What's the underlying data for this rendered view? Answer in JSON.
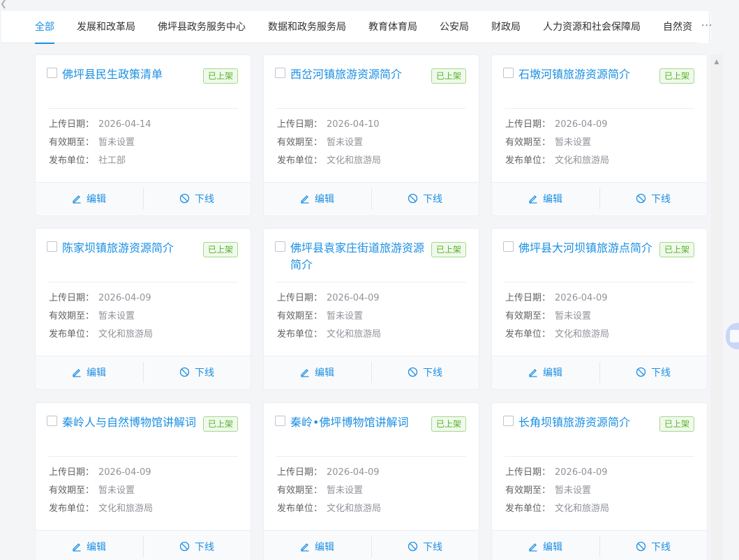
{
  "tabs": [
    {
      "label": "全部",
      "active": true
    },
    {
      "label": "发展和改革局",
      "active": false
    },
    {
      "label": "佛坪县政务服务中心",
      "active": false
    },
    {
      "label": "数据和政务服务局",
      "active": false
    },
    {
      "label": "教育体育局",
      "active": false
    },
    {
      "label": "公安局",
      "active": false
    },
    {
      "label": "财政局",
      "active": false
    },
    {
      "label": "人力资源和社会保障局",
      "active": false
    },
    {
      "label": "自然资",
      "active": false
    }
  ],
  "tab_more": "···",
  "labels": {
    "upload_date": "上传日期：",
    "valid_until": "有效期至：",
    "publisher": "发布单位：",
    "edit": "编辑",
    "offline": "下线"
  },
  "cards": [
    {
      "title": "佛坪县民生政策清单",
      "status": "已上架",
      "upload_date": "2026-04-14",
      "valid_until": "暂未设置",
      "publisher": "社工部"
    },
    {
      "title": "西岔河镇旅游资源简介",
      "status": "已上架",
      "upload_date": "2026-04-10",
      "valid_until": "暂未设置",
      "publisher": "文化和旅游局"
    },
    {
      "title": "石墩河镇旅游资源简介",
      "status": "已上架",
      "upload_date": "2026-04-09",
      "valid_until": "暂未设置",
      "publisher": "文化和旅游局"
    },
    {
      "title": "陈家坝镇旅游资源简介",
      "status": "已上架",
      "upload_date": "2026-04-09",
      "valid_until": "暂未设置",
      "publisher": "文化和旅游局"
    },
    {
      "title": "佛坪县袁家庄街道旅游资源简介",
      "status": "已上架",
      "upload_date": "2026-04-09",
      "valid_until": "暂未设置",
      "publisher": "文化和旅游局"
    },
    {
      "title": "佛坪县大河坝镇旅游点简介",
      "status": "已上架",
      "upload_date": "2026-04-09",
      "valid_until": "暂未设置",
      "publisher": "文化和旅游局"
    },
    {
      "title": "秦岭人与自然博物馆讲解词",
      "status": "已上架",
      "upload_date": "2026-04-09",
      "valid_until": "暂未设置",
      "publisher": "文化和旅游局"
    },
    {
      "title": "秦岭•佛坪博物馆讲解词",
      "status": "已上架",
      "upload_date": "2026-04-09",
      "valid_until": "暂未设置",
      "publisher": "文化和旅游局"
    },
    {
      "title": "长角坝镇旅游资源简介",
      "status": "已上架",
      "upload_date": "2026-04-09",
      "valid_until": "暂未设置",
      "publisher": "文化和旅游局"
    }
  ],
  "icons": {
    "edit": "pencil-icon",
    "offline": "prohibit-icon",
    "back": "chevron-left-icon",
    "scroll_up": "triangle-up-icon",
    "side": "assistant-bubble-icon"
  },
  "colors": {
    "accent": "#1a8fe3",
    "status_green": "#52b22a",
    "status_bg": "#f0f9eb"
  }
}
